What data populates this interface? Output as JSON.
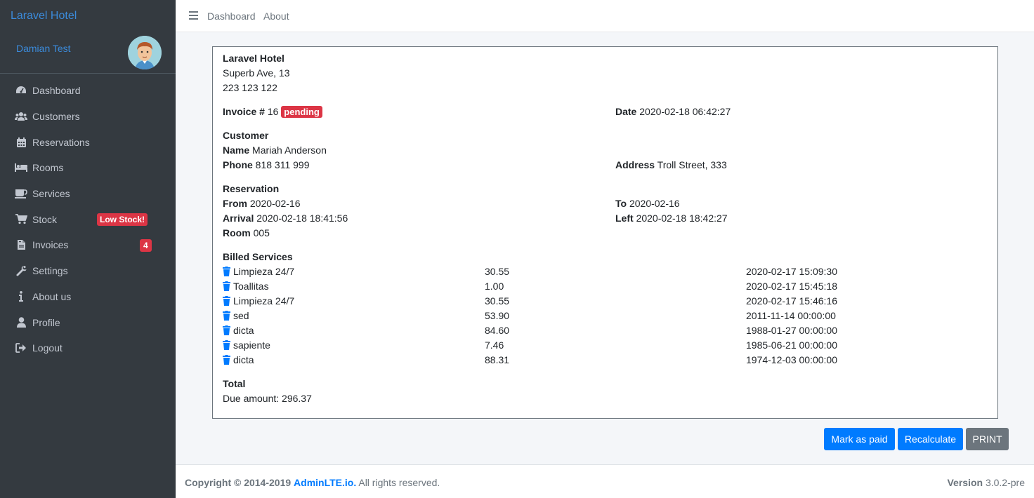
{
  "sidebar": {
    "brand": "Laravel Hotel",
    "user_name": "Damian Test",
    "items": [
      {
        "label": "Dashboard",
        "icon": "tachometer-icon"
      },
      {
        "label": "Customers",
        "icon": "users-icon"
      },
      {
        "label": "Reservations",
        "icon": "calendar-icon"
      },
      {
        "label": "Rooms",
        "icon": "bed-icon"
      },
      {
        "label": "Services",
        "icon": "coffee-icon"
      },
      {
        "label": "Stock",
        "icon": "cart-icon",
        "badge": "Low Stock!"
      },
      {
        "label": "Invoices",
        "icon": "file-invoice-icon",
        "badge": "4"
      },
      {
        "label": "Settings",
        "icon": "wrench-icon"
      },
      {
        "label": "About us",
        "icon": "info-icon"
      },
      {
        "label": "Profile",
        "icon": "user-icon"
      },
      {
        "label": "Logout",
        "icon": "sign-out-icon"
      }
    ]
  },
  "topbar": {
    "links": [
      "Dashboard",
      "About"
    ]
  },
  "invoice": {
    "hotel_name": "Laravel Hotel",
    "hotel_address": "Superb Ave, 13",
    "hotel_phone": "223 123 122",
    "invoice_label": "Invoice #",
    "invoice_number": "16",
    "status": "pending",
    "date_label": "Date",
    "date": "2020-02-18 06:42:27",
    "customer_heading": "Customer",
    "name_label": "Name",
    "name": "Mariah Anderson",
    "phone_label": "Phone",
    "phone": "818 311 999",
    "address_label": "Address",
    "address": "Troll Street, 333",
    "reservation_heading": "Reservation",
    "from_label": "From",
    "from": "2020-02-16",
    "to_label": "To",
    "to": "2020-02-16",
    "arrival_label": "Arrival",
    "arrival": "2020-02-18 18:41:56",
    "left_label": "Left",
    "left": "2020-02-18 18:42:27",
    "room_label": "Room",
    "room": "005",
    "services_heading": "Billed Services",
    "services": [
      {
        "name": "Limpieza 24/7",
        "price": "30.55",
        "date": "2020-02-17 15:09:30"
      },
      {
        "name": "Toallitas",
        "price": "1.00",
        "date": "2020-02-17 15:45:18"
      },
      {
        "name": "Limpieza 24/7",
        "price": "30.55",
        "date": "2020-02-17 15:46:16"
      },
      {
        "name": "sed",
        "price": "53.90",
        "date": "2011-11-14 00:00:00"
      },
      {
        "name": "dicta",
        "price": "84.60",
        "date": "1988-01-27 00:00:00"
      },
      {
        "name": "sapiente",
        "price": "7.46",
        "date": "1985-06-21 00:00:00"
      },
      {
        "name": "dicta",
        "price": "88.31",
        "date": "1974-12-03 00:00:00"
      }
    ],
    "total_heading": "Total",
    "due_amount": "Due amount: 296.37"
  },
  "actions": {
    "mark_paid": "Mark as paid",
    "recalculate": "Recalculate",
    "print": "PRINT"
  },
  "footer": {
    "copyright": "Copyright © 2014-2019",
    "brand_link": "AdminLTE.io.",
    "rights": "All rights reserved.",
    "version_label": "Version",
    "version": "3.0.2-pre"
  },
  "colors": {
    "sidebar_bg": "#343a40",
    "primary": "#007bff",
    "danger": "#dc3545",
    "secondary": "#6c757d"
  }
}
